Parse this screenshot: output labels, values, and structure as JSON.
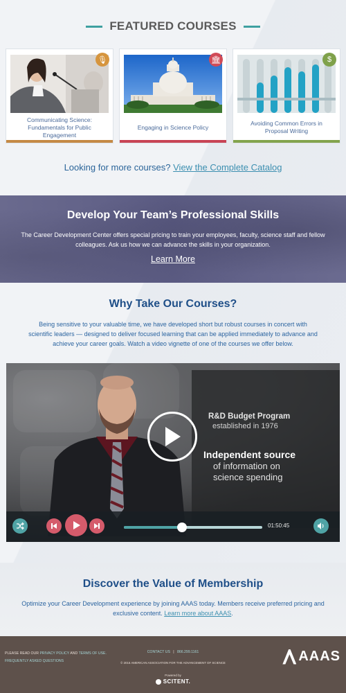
{
  "featured": {
    "heading": "FEATURED COURSES",
    "cards": [
      {
        "title": "Communicating Science: Fundamentals for Public Engagement",
        "badge_icon": "microphone-icon",
        "badge_color": "#d6953e",
        "bar_color": "#c58a45"
      },
      {
        "title": "Engaging in Science Policy",
        "badge_icon": "capitol-icon",
        "badge_color": "#d14b57",
        "bar_color": "#c84455"
      },
      {
        "title": "Avoiding Common Errors in Proposal Writing",
        "badge_icon": "dollar-icon",
        "badge_color": "#7fa14a",
        "bar_color": "#83a44d"
      }
    ],
    "more_prefix": "Looking for more courses?",
    "more_link": "View the Complete Catalog"
  },
  "develop": {
    "title": "Develop Your Team’s Professional Skills",
    "text": "The Career Development Center offers special pricing to train your employees, faculty, science staff and fellow colleagues. Ask us how we can advance the skills in your organization.",
    "link": "Learn More"
  },
  "why": {
    "title": "Why Take Our Courses?",
    "text": "Being sensitive to your valuable time, we have developed short but robust courses in concert with scientific leaders — designed to deliver focused learning that can be applied immediately to advance and achieve your career goals. Watch a video vignette of one of the courses we offer below."
  },
  "video": {
    "overlay_line1": "R&D Budget Program",
    "overlay_line2": "established in 1976",
    "overlay_line3": "Independent source",
    "overlay_line4": "of information on science spending",
    "time": "01:50:45",
    "progress": 0.42,
    "accent": "#4fa3a5",
    "control_color": "#d55b6b"
  },
  "membership": {
    "title": "Discover the Value of Membership",
    "text": "Optimize your Career Development experience by joining AAAS today. Members receive preferred pricing and exclusive content.",
    "link": "Learn more about AAAS"
  },
  "footer": {
    "read_prefix": "PLEASE READ OUR",
    "privacy": "PRIVACY POLICY",
    "and": "AND",
    "terms": "TERMS OF USE.",
    "faq": "FREQUENTLY ASKED QUESTIONS",
    "contact": "CONTACT US",
    "separator": "|",
    "phone": "866.299.1161",
    "copyright": "© 2016 AMERICAN ASSOCIATION FOR THE ADVANCEMENT OF SCIENCE",
    "powered_by": "Powered by",
    "powered_brand": "SCITENT.",
    "logo_text": "AAAS"
  }
}
